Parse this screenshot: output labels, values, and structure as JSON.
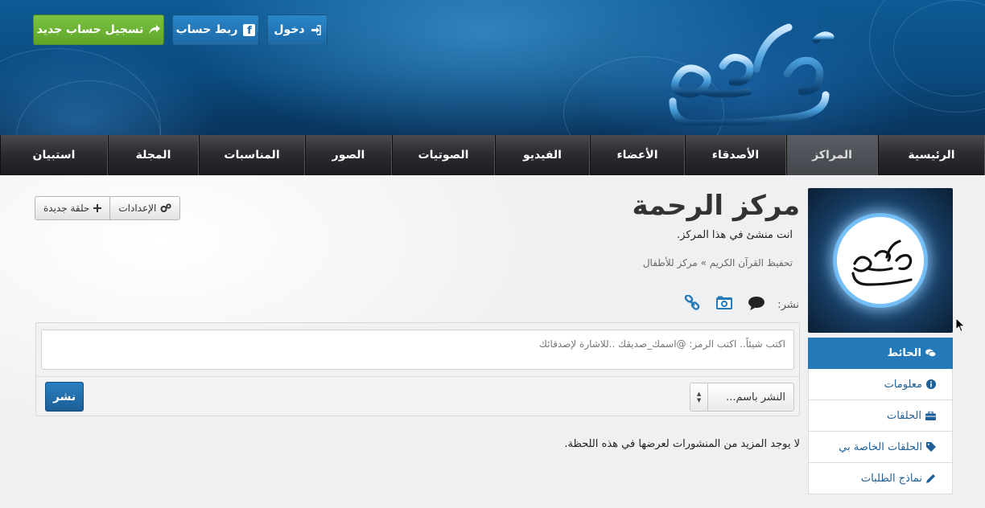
{
  "header": {
    "login_label": "دخول",
    "fb_label": "ربط حساب",
    "register_label": "تسجيل حساب جديد"
  },
  "nav": {
    "items": [
      "الرئيسية",
      "المراكز",
      "الأصدقاء",
      "الأعضاء",
      "الفيديو",
      "الصوتيات",
      "الصور",
      "المناسبات",
      "المجلة",
      "استبيان"
    ],
    "active": "المراكز"
  },
  "center": {
    "title": "مركز الرحمة",
    "creator_note": "انت منشئ في هذا المركز.",
    "categories": "تحفيظ القرآن الكريم » مركز للأطفال",
    "settings_label": "الإعدادات",
    "new_circle_label": "حلقة جديدة"
  },
  "composer": {
    "publish_label": "نشر:",
    "placeholder": "اكتب شيئاً.. اكتب الرمز: @اسمك_صديقك ..للاشارة لإصدقائك",
    "post_as": "النشر باسم...",
    "post_button": "نشر"
  },
  "feed": {
    "empty_message": "لا يوجد المزيد من المنشورات لعرضها في هذه اللحظة."
  },
  "sidebar": {
    "items": [
      {
        "label": "الحائط",
        "icon": "comments-icon"
      },
      {
        "label": "معلومات",
        "icon": "info-icon"
      },
      {
        "label": "الحلقات",
        "icon": "briefcase-icon"
      },
      {
        "label": "الحلقات الخاصة بي",
        "icon": "tag-icon"
      },
      {
        "label": "نماذج الطلبات",
        "icon": "pencil-icon"
      }
    ]
  },
  "colors": {
    "primary": "#2479b8",
    "register": "#6bb436",
    "nav_dark": "#2b2d32"
  }
}
